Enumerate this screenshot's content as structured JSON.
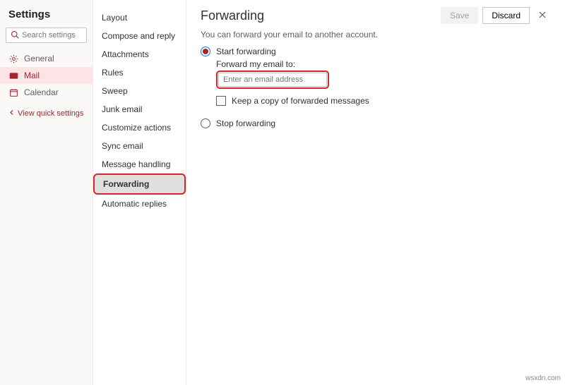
{
  "sidebar": {
    "title": "Settings",
    "search_placeholder": "Search settings",
    "items": [
      {
        "label": "General"
      },
      {
        "label": "Mail"
      },
      {
        "label": "Calendar"
      }
    ],
    "quick_settings": "View quick settings"
  },
  "subnav": {
    "items": [
      {
        "label": "Layout"
      },
      {
        "label": "Compose and reply"
      },
      {
        "label": "Attachments"
      },
      {
        "label": "Rules"
      },
      {
        "label": "Sweep"
      },
      {
        "label": "Junk email"
      },
      {
        "label": "Customize actions"
      },
      {
        "label": "Sync email"
      },
      {
        "label": "Message handling"
      },
      {
        "label": "Forwarding"
      },
      {
        "label": "Automatic replies"
      }
    ]
  },
  "main": {
    "title": "Forwarding",
    "save_label": "Save",
    "discard_label": "Discard",
    "description": "You can forward your email to another account.",
    "start_label": "Start forwarding",
    "forward_to_label": "Forward my email to:",
    "email_placeholder": "Enter an email address",
    "keep_copy_label": "Keep a copy of forwarded messages",
    "stop_label": "Stop forwarding"
  },
  "watermark": "wsxdn.com"
}
